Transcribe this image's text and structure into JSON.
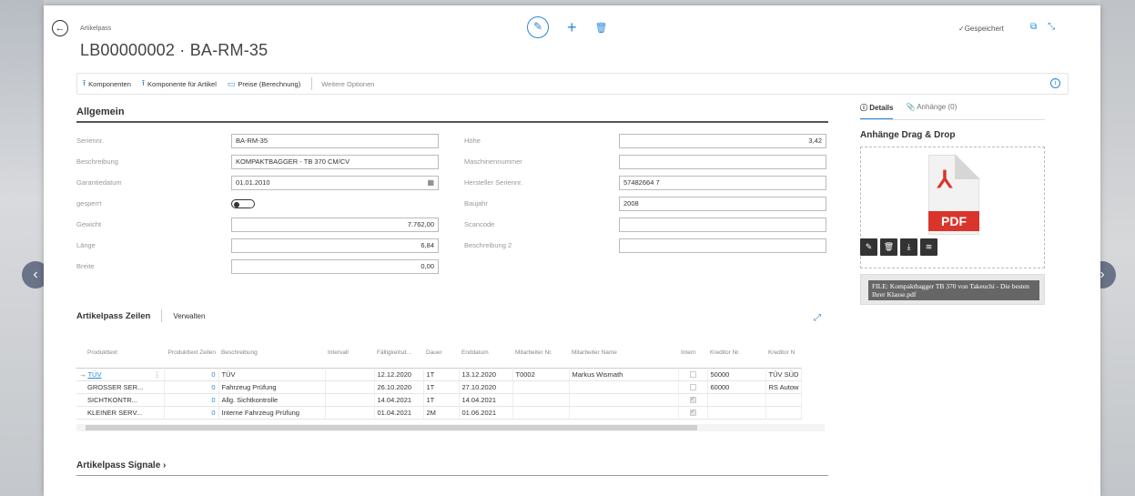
{
  "header": {
    "breadcrumb": "Artikelpass",
    "title": "LB00000002 · BA-RM-35",
    "saved_status": "Gespeichert"
  },
  "actions": [
    {
      "label": "Komponenten",
      "icon": "component-icon"
    },
    {
      "label": "Komponente für Artikel",
      "icon": "component-icon"
    },
    {
      "label": "Preise (Berechnung)",
      "icon": "price-icon"
    }
  ],
  "more_options": "Weitere Optionen",
  "general": {
    "section_title": "Allgemein",
    "left_fields": [
      {
        "label": "Seriennr.",
        "value": "BA-RM-35"
      },
      {
        "label": "Beschreibung",
        "value": "KOMPAKTBAGGER - TB 370 CM/CV"
      },
      {
        "label": "Garantiedatum",
        "value": "01.01.2010"
      },
      {
        "label": "gesperrt",
        "value": ""
      },
      {
        "label": "Gewicht",
        "value": "7.762,00"
      },
      {
        "label": "Länge",
        "value": "6,84"
      },
      {
        "label": "Breite",
        "value": "0,00"
      }
    ],
    "right_fields": [
      {
        "label": "Höhe",
        "value": "3,42"
      },
      {
        "label": "Maschinennummer",
        "value": ""
      },
      {
        "label": "Hersteller Seriennr.",
        "value": "57482664 7"
      },
      {
        "label": "Baujahr",
        "value": "2008"
      },
      {
        "label": "Scancode",
        "value": ""
      },
      {
        "label": "Beschreibung 2",
        "value": ""
      }
    ]
  },
  "lines": {
    "title": "Artikelpass Zeilen",
    "manage": "Verwalten",
    "columns": [
      "Produkttext",
      "Produkttext Zeilen",
      "Beschreibung",
      "Intervall",
      "Fälligkeitsd...",
      "Dauer",
      "Enddatum",
      "Mitarbeiter Nr.",
      "Mitarbeiter Name",
      "Intern",
      "Kreditor Nr.",
      "Kreditor N"
    ],
    "rows": [
      {
        "produkttext": "TÜV",
        "zeilen": "0",
        "beschreibung": "TÜV",
        "intervall": "",
        "faellig": "12.12.2020",
        "dauer": "1T",
        "ende": "13.12.2020",
        "ma_nr": "T0002",
        "ma_name": "Markus Wismath",
        "intern": false,
        "kred_nr": "50000",
        "kred_name": "TÜV SÜD"
      },
      {
        "produkttext": "GROSSER SER...",
        "zeilen": "0",
        "beschreibung": "Fahrzeug Prüfung",
        "intervall": "",
        "faellig": "26.10.2020",
        "dauer": "1T",
        "ende": "27.10.2020",
        "ma_nr": "",
        "ma_name": "",
        "intern": false,
        "kred_nr": "60000",
        "kred_name": "RS Autow"
      },
      {
        "produkttext": "SICHTKONTR...",
        "zeilen": "0",
        "beschreibung": "Allg. Sichtkontrolle",
        "intervall": "",
        "faellig": "14.04.2021",
        "dauer": "1T",
        "ende": "14.04.2021",
        "ma_nr": "",
        "ma_name": "",
        "intern": true,
        "kred_nr": "",
        "kred_name": ""
      },
      {
        "produkttext": "KLEINER SERV...",
        "zeilen": "0",
        "beschreibung": "Interne Fahrzeug Prüfung",
        "intervall": "",
        "faellig": "01.04.2021",
        "dauer": "2M",
        "ende": "01.06.2021",
        "ma_nr": "",
        "ma_name": "",
        "intern": true,
        "kred_nr": "",
        "kred_name": ""
      }
    ]
  },
  "signals_title": "Artikelpass Signale",
  "factbox": {
    "tab_details": "Details",
    "tab_attachments": "Anhänge (0)",
    "dd_title": "Anhänge Drag & Drop",
    "pdf_label": "PDF",
    "file_tooltip": "FILE: Kompaktbagger TB 370 von Takeuchi - Die besten Ihrer Klasse.pdf"
  },
  "colors": {
    "accent": "#2b88d8",
    "pdf_red": "#d9352c"
  }
}
